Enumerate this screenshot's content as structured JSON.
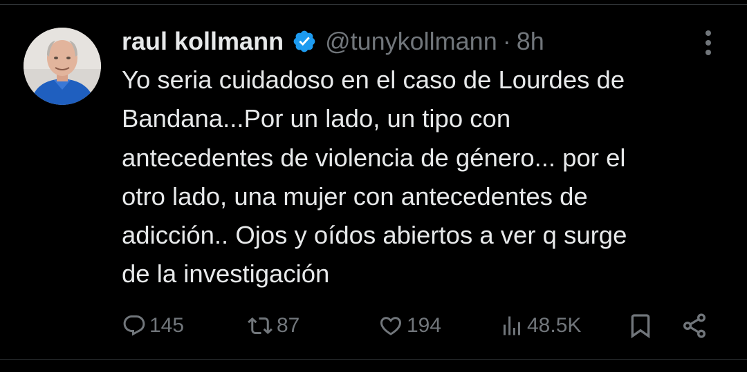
{
  "tweet": {
    "author_name": "raul kollmann",
    "handle": "@tunykollmann",
    "separator": "·",
    "time": "8h",
    "text": "Yo seria cuidadoso en el caso de Lourdes de\nBandana...Por un lado, un tipo con\nantecedentes de violencia de género... por el\notro lado, una mujer con antecedentes de\nadicción.. Ojos y oídos abiertos a ver q surge\nde la investigación"
  },
  "actions": {
    "replies": "145",
    "retweets": "87",
    "likes": "194",
    "views": "48.5K"
  },
  "icons": {
    "reply": "reply-icon",
    "retweet": "retweet-icon",
    "like": "heart-icon",
    "views": "views-icon",
    "bookmark": "bookmark-icon",
    "share": "share-icon",
    "verified": "verified-badge-icon",
    "more": "more-icon"
  },
  "colors": {
    "background": "#000000",
    "text": "#e7e9ea",
    "secondary": "#71767b",
    "verified": "#1d9bf0"
  }
}
